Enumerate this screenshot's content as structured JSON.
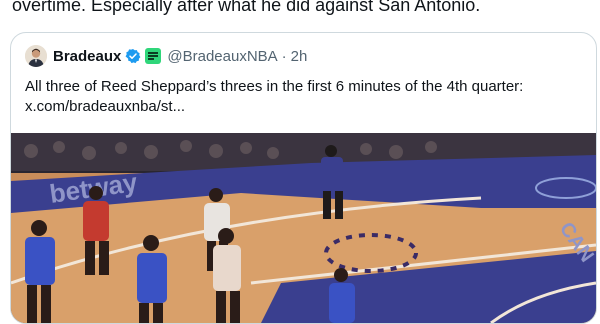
{
  "tweet": {
    "text": "overtime. Especially after what he did against San Antonio."
  },
  "quote": {
    "display_name": "Bradeaux",
    "handle": "@BradeauxNBA",
    "separator": "·",
    "time": "2h",
    "body": "All three of Reed Sheppard’s threes in the first 6 minutes of the 4th quarter:",
    "link": "x.com/bradeauxnba/st...",
    "verified_icon": "verified-badge-icon",
    "affiliate_icon": "brand-affiliate-icon",
    "colors": {
      "verified": "#1d9bf0",
      "affiliate": "#2fd67a",
      "court_floor": "#d59a63",
      "court_paint": "#3a3f8f"
    }
  },
  "media": {
    "court_text": "betway",
    "court_logo_text": "CAN"
  }
}
